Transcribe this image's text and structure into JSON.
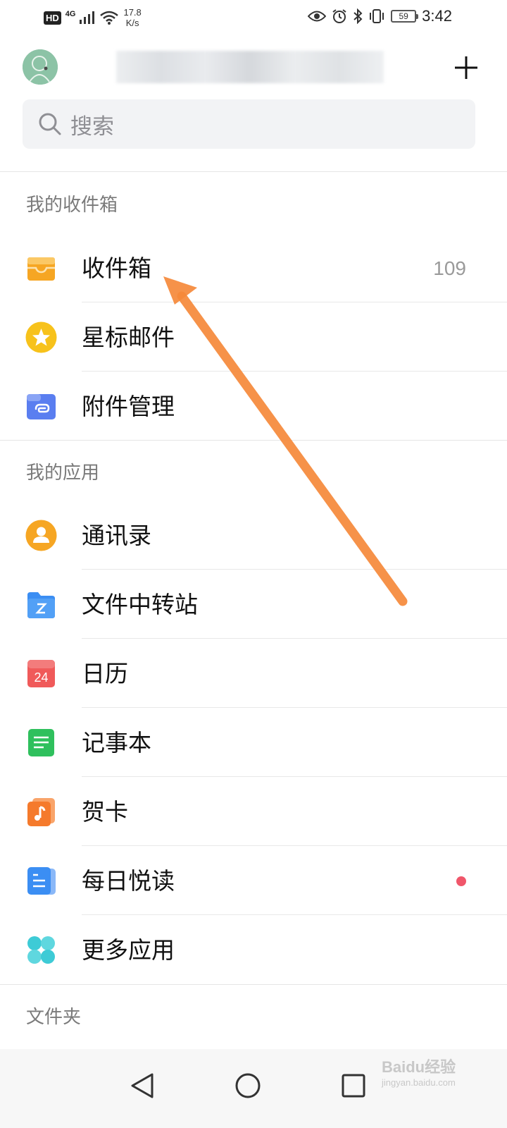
{
  "status_bar": {
    "hd": "HD",
    "network": "4G",
    "speed_value": "17.8",
    "speed_unit": "K/s",
    "battery": "59",
    "time": "3:42"
  },
  "search": {
    "placeholder": "搜索"
  },
  "sections": {
    "inbox_title": "我的收件箱",
    "apps_title": "我的应用",
    "folders_title": "文件夹"
  },
  "inbox_items": [
    {
      "label": "收件箱",
      "count": "109",
      "icon": "inbox-tray-icon",
      "color": "#f6a623"
    },
    {
      "label": "星标邮件",
      "icon": "star-icon",
      "color": "#f7c21b"
    },
    {
      "label": "附件管理",
      "icon": "paperclip-folder-icon",
      "color": "#5a7ef0"
    }
  ],
  "apps": [
    {
      "label": "通讯录",
      "icon": "contacts-icon",
      "color": "#f6a623"
    },
    {
      "label": "文件中转站",
      "icon": "folder-z-icon",
      "color": "#3b8ef3"
    },
    {
      "label": "日历",
      "icon": "calendar-icon",
      "day": "24",
      "color": "#f05a5a"
    },
    {
      "label": "记事本",
      "icon": "notepad-icon",
      "color": "#2fc05d"
    },
    {
      "label": "贺卡",
      "icon": "music-card-icon",
      "color": "#f57a2c"
    },
    {
      "label": "每日悦读",
      "icon": "reading-icon",
      "color": "#3b8ef3",
      "badge_color": "#f0566a"
    },
    {
      "label": "更多应用",
      "icon": "more-apps-icon",
      "color": "#3ecbd6"
    }
  ],
  "watermark": {
    "brand": "Baidu经验",
    "url": "jingyan.baidu.com"
  },
  "colors": {
    "annotation_arrow": "#f5893a"
  }
}
